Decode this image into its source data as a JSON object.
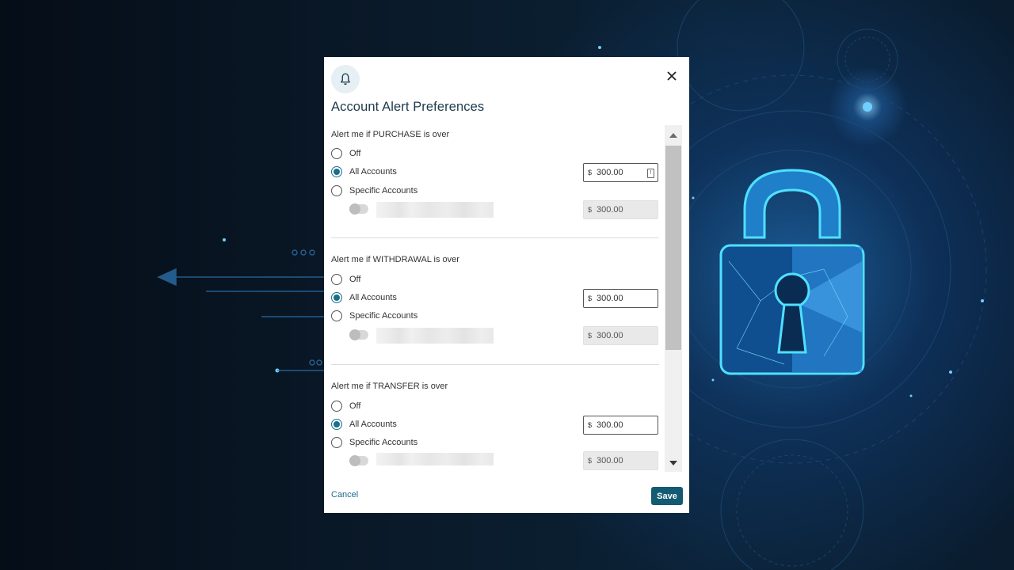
{
  "modal": {
    "title": "Account Alert Preferences",
    "icon": "bell-icon",
    "close_icon": "close-icon",
    "cancel_label": "Cancel",
    "save_label": "Save"
  },
  "sections": [
    {
      "label": "Alert me if PURCHASE is over",
      "options": [
        "Off",
        "All Accounts",
        "Specific Accounts"
      ],
      "selected": "All Accounts",
      "currency": "$",
      "all_amount": "300.00",
      "specific_amount": "300.00"
    },
    {
      "label": "Alert me if WITHDRAWAL is over",
      "options": [
        "Off",
        "All Accounts",
        "Specific Accounts"
      ],
      "selected": "All Accounts",
      "currency": "$",
      "all_amount": "300.00",
      "specific_amount": "300.00"
    },
    {
      "label": "Alert me if TRANSFER is over",
      "options": [
        "Off",
        "All Accounts",
        "Specific Accounts"
      ],
      "selected": "All Accounts",
      "currency": "$",
      "all_amount": "300.00",
      "specific_amount": "300.00"
    }
  ],
  "colors": {
    "accent": "#1a6e8c",
    "save_button": "#145a73",
    "background": "#06121f",
    "lock_glow": "#39c6ff"
  }
}
